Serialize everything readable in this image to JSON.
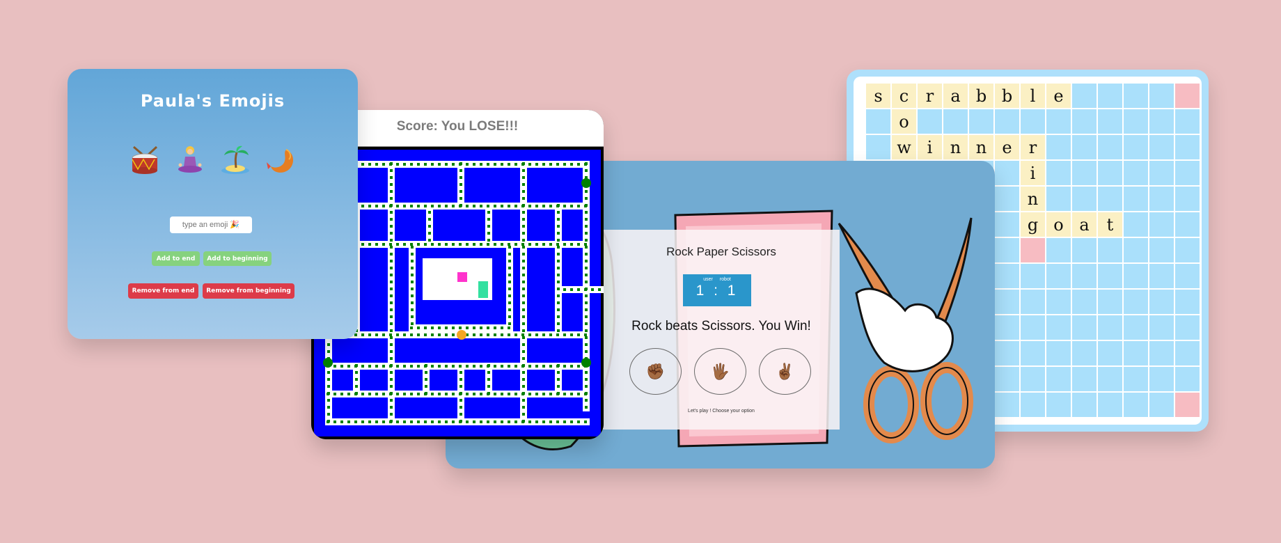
{
  "emoji_app": {
    "title": "Paula's Emojis",
    "emojis": [
      "drum",
      "person-in-lotus-position",
      "desert-island",
      "fried-shrimp"
    ],
    "input_placeholder": "type an emoji 🎉",
    "buttons": {
      "add_end": "Add to end",
      "add_beginning": "Add to beginning",
      "remove_end": "Remove from end",
      "remove_beginning": "Remove from beginning"
    },
    "colors": {
      "add": "#86d27e",
      "remove": "#dd3b49",
      "gradient_top": "#62a6d8",
      "gradient_bottom": "#a6cbea"
    }
  },
  "pacman": {
    "score_text": "Score: You LOSE!!!",
    "colors": {
      "wall": "#0000ff",
      "path": "#ffffff",
      "dot": "#008000",
      "ghost_magenta": "#ff33cc",
      "ghost_green": "#33e0a0",
      "pacman": "#f5a623"
    }
  },
  "rps": {
    "title": "Rock Paper Scissors",
    "score_labels": [
      "user",
      "robot"
    ],
    "score": "1 : 1",
    "result": "Rock beats Scissors. You Win!",
    "choices": [
      "rock-fist-icon",
      "paper-hand-icon",
      "scissors-victory-hand-icon"
    ],
    "message": "Let's play ! Choose your option"
  },
  "scrabble": {
    "words": [
      "scrabble",
      "so",
      "winner",
      "ring",
      "goat"
    ],
    "rows": [
      [
        "s",
        "c",
        "r",
        "a",
        "b",
        "b",
        "l",
        "e",
        "",
        "",
        "",
        "",
        ""
      ],
      [
        "",
        "o",
        "",
        "",
        "",
        "",
        "",
        "",
        "",
        "",
        "",
        "",
        ""
      ],
      [
        "",
        "w",
        "i",
        "n",
        "n",
        "e",
        "r",
        "",
        "",
        "",
        "",
        "",
        ""
      ],
      [
        "",
        "",
        "",
        "",
        "",
        "",
        "i",
        "",
        "",
        "",
        "",
        "",
        ""
      ],
      [
        "",
        "",
        "",
        "",
        "",
        "",
        "n",
        "",
        "",
        "",
        "",
        "",
        ""
      ],
      [
        "",
        "",
        "",
        "",
        "",
        "",
        "g",
        "o",
        "a",
        "t",
        "",
        "",
        ""
      ],
      [
        "",
        "",
        "",
        "",
        "",
        "",
        "",
        "",
        "",
        "",
        "",
        "",
        ""
      ],
      [
        "",
        "",
        "",
        "",
        "",
        "",
        "",
        "",
        "",
        "",
        "",
        "",
        ""
      ],
      [
        "",
        "",
        "",
        "",
        "",
        "",
        "",
        "",
        "",
        "",
        "",
        "",
        ""
      ],
      [
        "",
        "",
        "",
        "",
        "",
        "",
        "",
        "",
        "",
        "",
        "",
        "",
        ""
      ],
      [
        "",
        "",
        "",
        "",
        "",
        "",
        "",
        "",
        "",
        "",
        "",
        "",
        ""
      ],
      [
        "",
        "",
        "",
        "",
        "",
        "",
        "",
        "",
        "",
        "",
        "",
        "",
        ""
      ],
      [
        "",
        "",
        "",
        "",
        "",
        "",
        "",
        "",
        "",
        "",
        "",
        "",
        ""
      ]
    ],
    "colors": {
      "empty": "#aae0fb",
      "letter": "#fbf0c4",
      "bonus": "#f7bcc2"
    }
  }
}
